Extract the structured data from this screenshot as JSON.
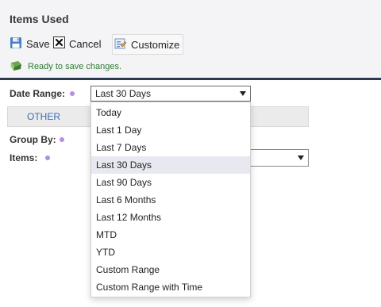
{
  "panel": {
    "title": "Items Used"
  },
  "toolbar": {
    "save_label": "Save",
    "cancel_label": "Cancel",
    "customize_label": "Customize"
  },
  "status": {
    "message": "Ready to save changes.",
    "color": "#2e7d32"
  },
  "form": {
    "date_range": {
      "label": "Date Range:",
      "value": "Last 30 Days"
    },
    "tab": {
      "label": "OTHER"
    },
    "group_by": {
      "label": "Group By:"
    },
    "items": {
      "label": "Items:"
    },
    "required_dot_color": "#b28ee8"
  },
  "date_range_dropdown": {
    "options": [
      "Today",
      "Last 1 Day",
      "Last 7 Days",
      "Last 30 Days",
      "Last 90 Days",
      "Last 6 Months",
      "Last 12 Months",
      "MTD",
      "YTD",
      "Custom Range",
      "Custom Range with Time"
    ],
    "selected_index": 3
  },
  "icons": {
    "save": "floppy-disk-icon",
    "cancel": "x-box-icon",
    "customize": "customize-icon",
    "status": "flag-icon",
    "required": "required-dot-icon",
    "caret": "chevron-down-icon"
  }
}
